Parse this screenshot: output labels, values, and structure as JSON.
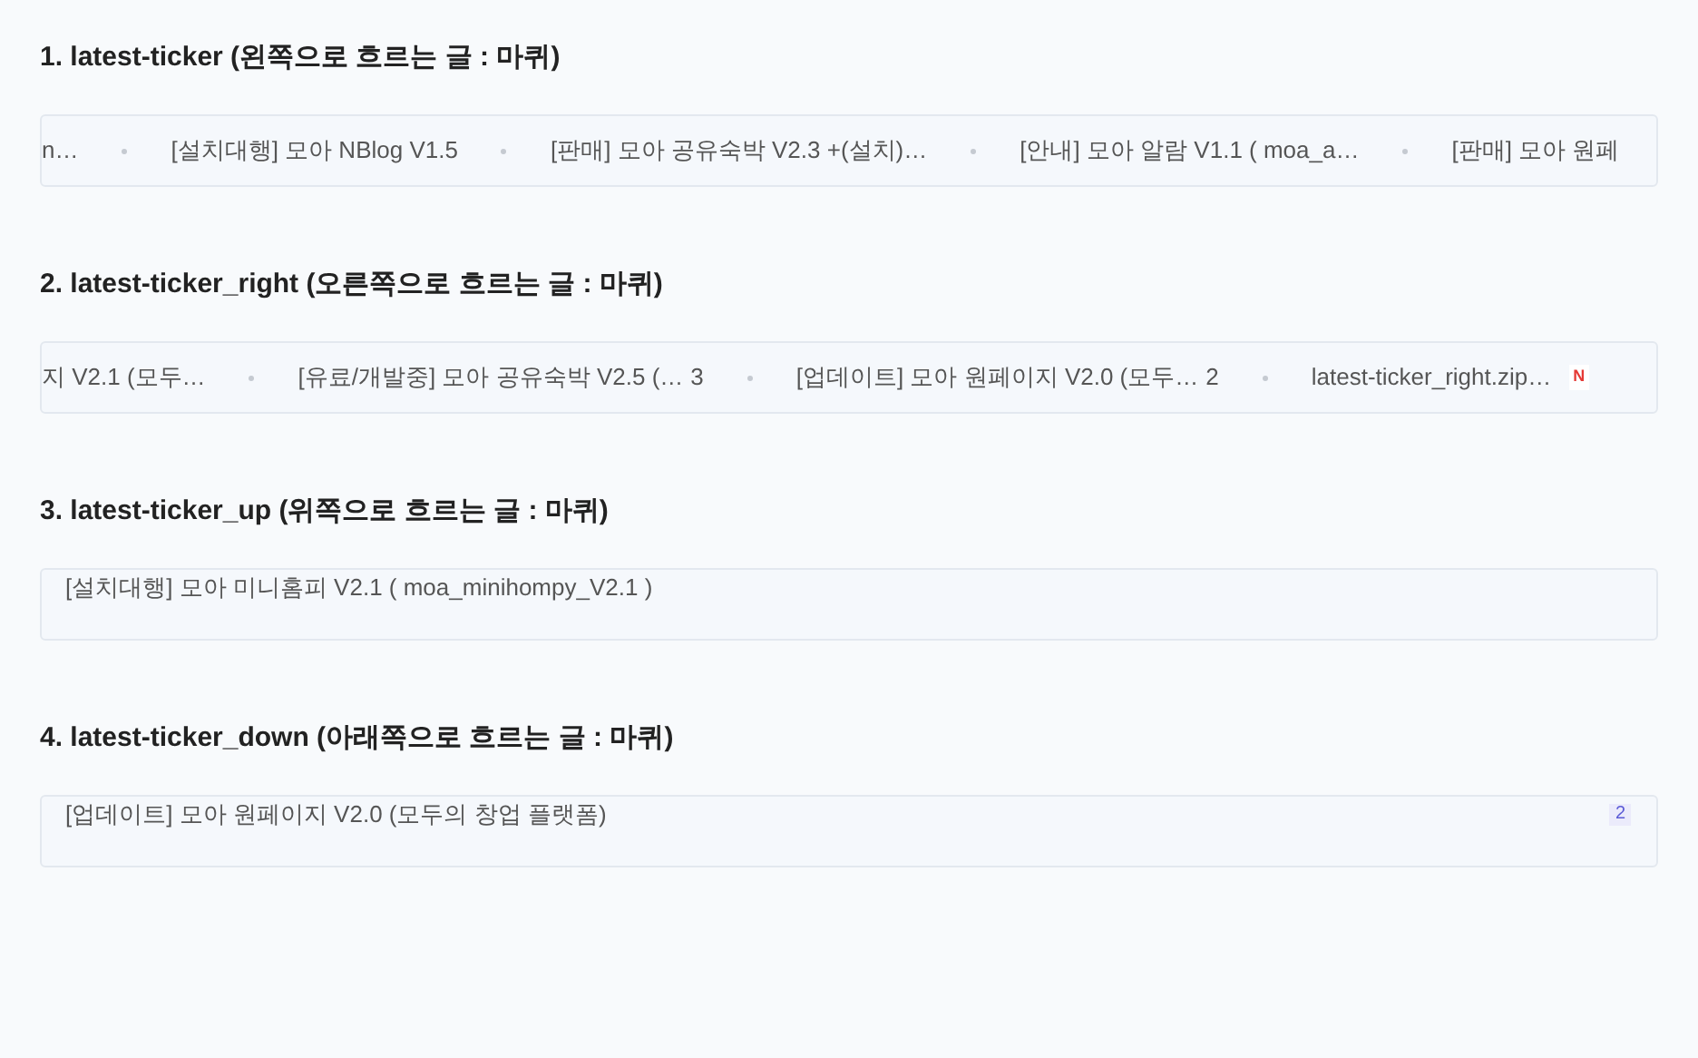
{
  "sections": [
    {
      "title": "1. latest-ticker (왼쪽으로 흐르는 글 : 마퀴)",
      "kind": "horizontal",
      "items": [
        {
          "text": "n…"
        },
        {
          "text": "[설치대행] 모아 NBlog V1.5"
        },
        {
          "text": "[판매] 모아 공유숙박 V2.3 +(설치)…"
        },
        {
          "text": "[안내] 모아 알람 V1.1 ( moa_a…"
        },
        {
          "text": "[판매] 모아 원페"
        }
      ]
    },
    {
      "title": "2. latest-ticker_right (오른쪽으로 흐르는 글 : 마퀴)",
      "kind": "horizontal",
      "items": [
        {
          "text": "지 V2.1 (모두…"
        },
        {
          "text": "[유료/개발중] 모아 공유숙박 V2.5 (…",
          "count": "3"
        },
        {
          "text": "[업데이트] 모아 원페이지 V2.0 (모두…",
          "count": "2"
        },
        {
          "text": "latest-ticker_right.zip…",
          "badge": "N"
        }
      ]
    },
    {
      "title": "3. latest-ticker_up (위쪽으로 흐르는 글 : 마퀴)",
      "kind": "vertical",
      "items": [
        {
          "text": "[설치대행] 모아 미니홈피 V2.1 ( moa_minihompy_V2.1 )"
        }
      ]
    },
    {
      "title": "4. latest-ticker_down (아래쪽으로 흐르는 글 : 마퀴)",
      "kind": "vertical",
      "items": [
        {
          "text": "[업데이트] 모아 원페이지 V2.0 (모두의 창업 플랫폼)",
          "count": "2"
        }
      ]
    }
  ]
}
